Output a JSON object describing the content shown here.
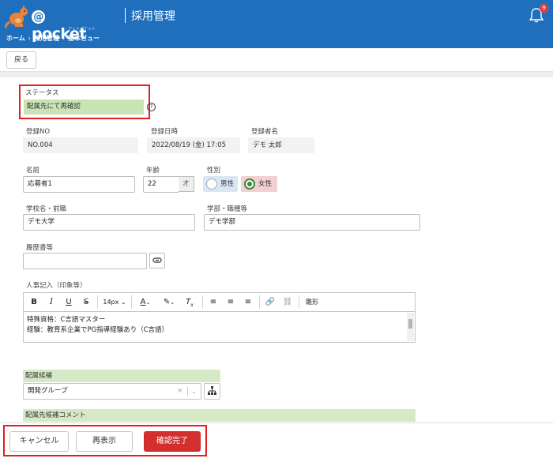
{
  "header": {
    "brand": "pocket",
    "brand_at": "@",
    "brand_sub": "アットポケット",
    "title": "採用管理",
    "notification_count": "9"
  },
  "breadcrumb": [
    "ホーム",
    "採用管理",
    "基本ビュー"
  ],
  "toolbar": {
    "back_label": "戻る"
  },
  "form": {
    "status": {
      "label": "ステータス",
      "value": "配属先にて再確認"
    },
    "reg_no": {
      "label": "登録NO",
      "value": "NO.004"
    },
    "reg_datetime": {
      "label": "登録日時",
      "value": "2022/08/19 (金) 17:05"
    },
    "registrant": {
      "label": "登録者名",
      "value": "デモ 太郎"
    },
    "name": {
      "label": "名前",
      "value": "応募者1"
    },
    "age": {
      "label": "年齢",
      "value": "22",
      "unit": "才"
    },
    "gender": {
      "label": "性別",
      "options": [
        "男性",
        "女性"
      ],
      "selected": "女性"
    },
    "school": {
      "label": "学校名・前職",
      "value": "デモ大学"
    },
    "department": {
      "label": "学部・職種等",
      "value": "デモ学部"
    },
    "resume": {
      "label": "履歴書等",
      "value": ""
    },
    "hr_notes": {
      "label": "人事記入（印象等）",
      "font_size": "14px",
      "template_label": "雛形",
      "lines": [
        "特殊資格：C言語マスター",
        "経験：教育系企業でPG指導経験あり（C言語）"
      ]
    },
    "placement_candidate": {
      "label": "配属候補",
      "value": "開発グループ"
    },
    "placement_comment": {
      "label": "配属先候補コメント"
    }
  },
  "footer": {
    "cancel_label": "キャンセル",
    "reload_label": "再表示",
    "confirm_label": "確認完了"
  },
  "colors": {
    "header_bg": "#1f6fbd",
    "highlight_border": "#e02020",
    "status_bg": "#c9e3b5",
    "confirm_bg": "#d32f2f"
  }
}
